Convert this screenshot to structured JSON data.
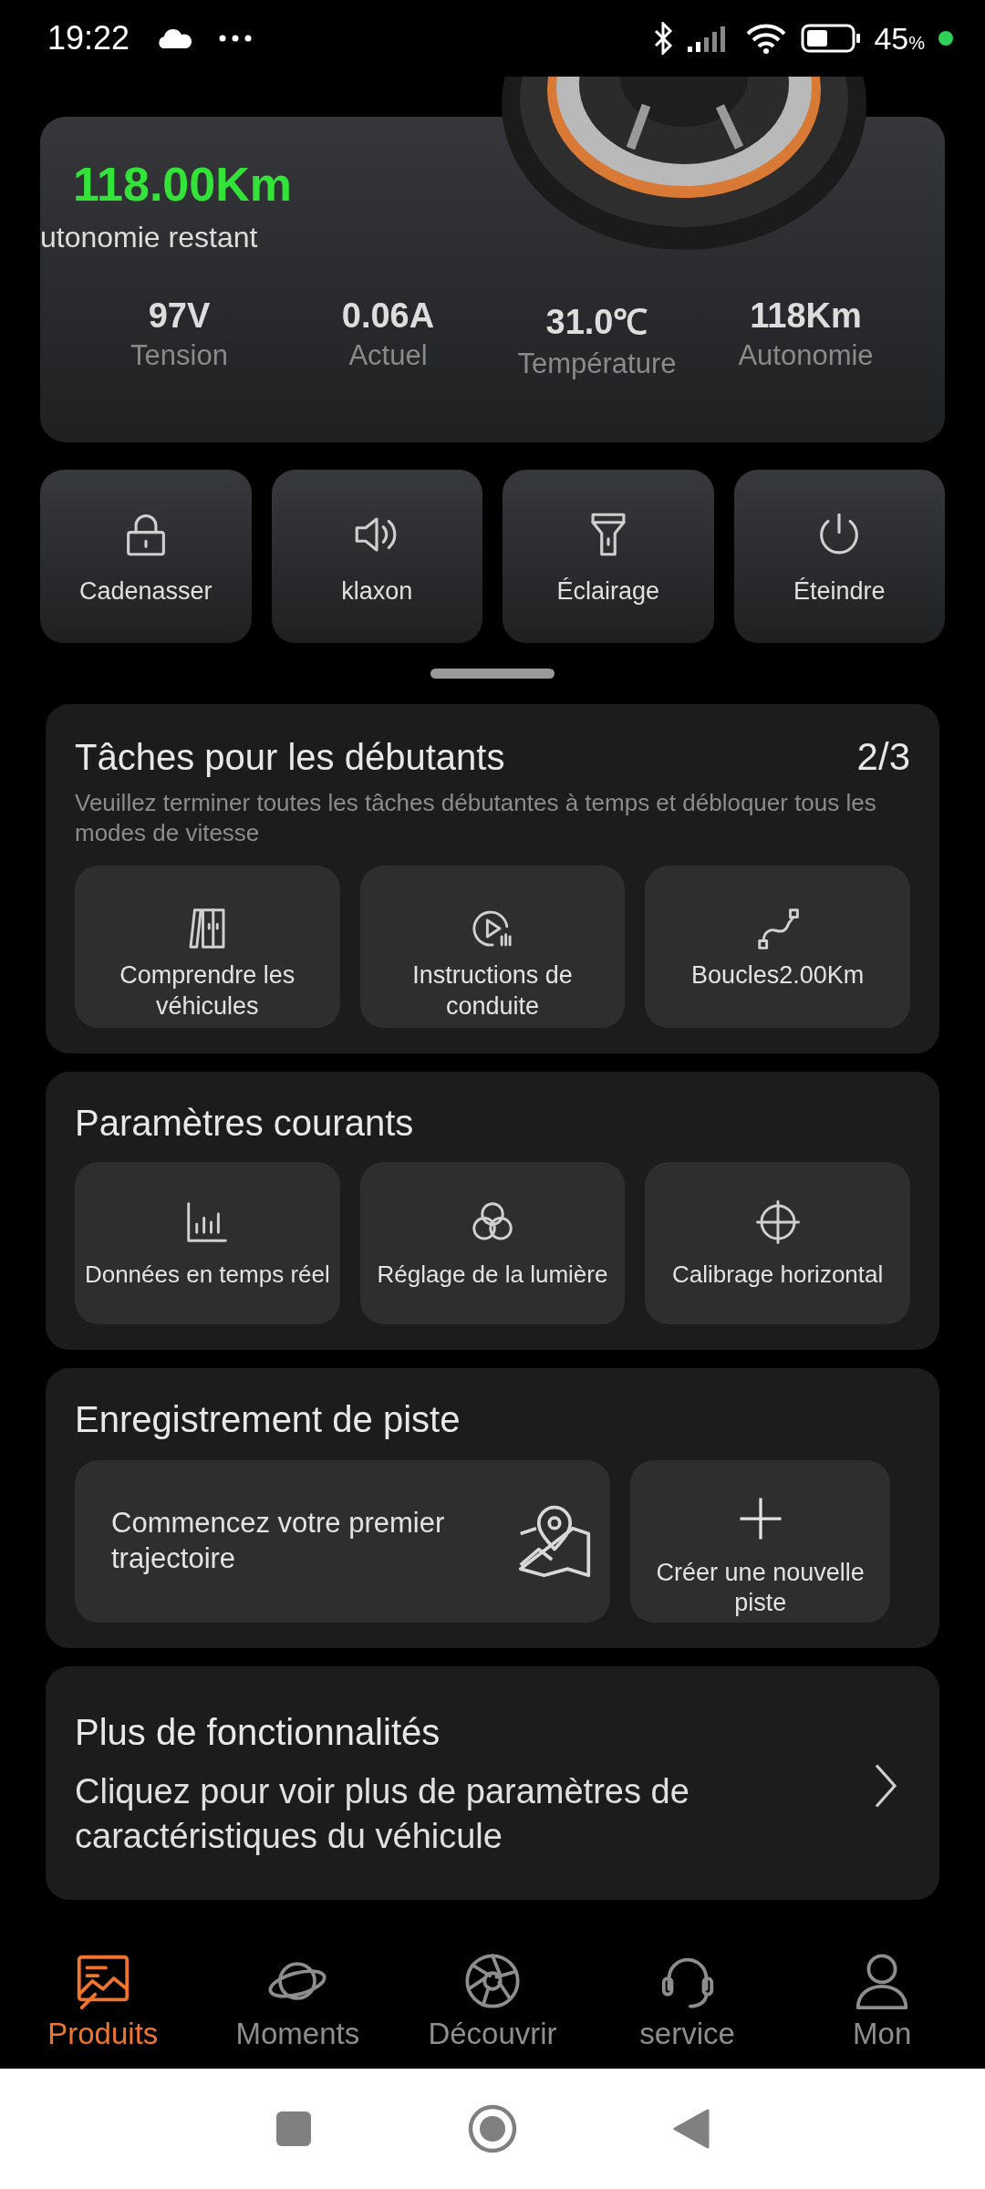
{
  "status_bar": {
    "time": "19:22",
    "battery": "45",
    "battery_unit": "%"
  },
  "range_card": {
    "remaining": "118.00Km",
    "remaining_label": "utonomie restant",
    "stats": [
      {
        "value": "97V",
        "label": "Tension"
      },
      {
        "value": "0.06A",
        "label": "Actuel"
      },
      {
        "value": "31.0℃",
        "label": "Température"
      },
      {
        "value": "118Km",
        "label": "Autonomie"
      }
    ]
  },
  "controls": [
    {
      "kind": "lock",
      "label": "Cadenasser"
    },
    {
      "kind": "horn",
      "label": "klaxon"
    },
    {
      "kind": "light",
      "label": "Éclairage"
    },
    {
      "kind": "power",
      "label": "Éteindre"
    }
  ],
  "beginner_tasks": {
    "title": "Tâches pour les débutants",
    "progress": "2/3",
    "description": "Veuillez terminer toutes les tâches débutantes à temps et débloquer tous les modes de vitesse",
    "items": [
      {
        "kind": "doors",
        "label": "Comprendre les véhicules"
      },
      {
        "kind": "play",
        "label": "Instructions de conduite"
      },
      {
        "kind": "route",
        "label": "Boucles2.00Km"
      }
    ]
  },
  "common_settings": {
    "title": "Paramètres courants",
    "items": [
      {
        "kind": "chart",
        "label": "Données en temps réel"
      },
      {
        "kind": "circles",
        "label": "Réglage de la lumière"
      },
      {
        "kind": "target",
        "label": "Calibrage horizontal"
      }
    ]
  },
  "track_recording": {
    "title": "Enregistrement de piste",
    "start_text": "Commencez votre premier trajectoire",
    "create_label": "Créer une nouvelle piste"
  },
  "more_features": {
    "title": "Plus de fonctionnalités",
    "description": "Cliquez pour voir plus de paramètres de caractéristiques du véhicule"
  },
  "bottom_nav": [
    {
      "kind": "products",
      "label": "Produits",
      "selected": true
    },
    {
      "kind": "planet",
      "label": "Moments",
      "selected": false
    },
    {
      "kind": "aperture",
      "label": "Découvrir",
      "selected": false
    },
    {
      "kind": "headset",
      "label": "service",
      "selected": false
    },
    {
      "kind": "person",
      "label": "Mon",
      "selected": false
    }
  ]
}
